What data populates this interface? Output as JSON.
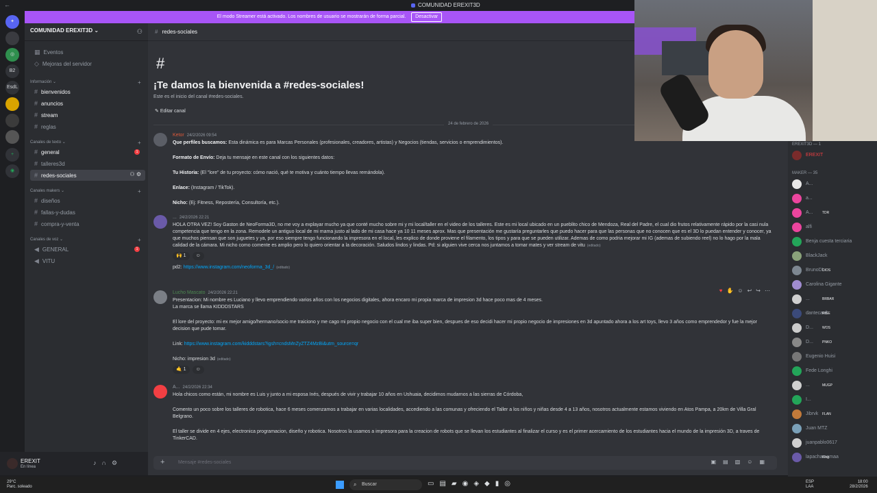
{
  "window": {
    "title": "COMUNIDAD EREXIT3D"
  },
  "banner": {
    "text": "El modo Streamer está activado. Los nombres de usuario se mostrarán de forma parcial.",
    "button": "Desactivar"
  },
  "rail": {
    "items": [
      "B2",
      "EsdL"
    ]
  },
  "server": {
    "name": "COMUNIDAD EREXIT3D"
  },
  "sidebar": {
    "top_items": [
      "Eventos",
      "Mejoras del servidor"
    ],
    "categories": {
      "info": "Información",
      "text": "Canales de texto",
      "makers": "Canales makers",
      "voice": "Canales de voz"
    },
    "info_channels": [
      "bienvenidos",
      "anuncios",
      "stream",
      "reglas"
    ],
    "text_channels": [
      "general",
      "talleres3d",
      "redes-sociales"
    ],
    "maker_channels": [
      "diseños",
      "fallas-y-dudas",
      "compra-y-venta"
    ],
    "voice_channels": [
      "GENERAL",
      "VITU"
    ],
    "general_badge": "1",
    "voice_badge": "1"
  },
  "user": {
    "name": "EREXIT",
    "status": "En línea"
  },
  "chat": {
    "channel": "redes-sociales",
    "welcome_title": "¡Te damos la bienvenida a #redes-sociales!",
    "welcome_sub": "Este es el inicio del canal #redes-sociales.",
    "edit_channel": "Editar canal",
    "date_divider": "24 de febrero de 2026",
    "input_placeholder": "Mensaje #redes-sociales",
    "edited": "(editado)"
  },
  "messages": [
    {
      "author": "Ketor",
      "timestamp": "24/2/2026 09:54",
      "p1_bold": "Que perfiles buscamos:",
      "p1": "Esta dinámica es para Marcas Personales (profesionales, creadores, artistas) y Negocios (tiendas, servicios o emprendimientos).",
      "p2_bold": "Formato de Envío:",
      "p2": "Deja tu mensaje en este canal con los siguientes datos:",
      "p3_bold": "Tu Historia:",
      "p3": "(El \"lore\" de tu proyecto: cómo nació, qué te motiva y cuánto tiempo llevas remándola).",
      "p4_bold": "Enlace:",
      "p4": "(Instagram / TikTok).",
      "p5_bold": "Nicho:",
      "p5": "(Ej: Fitness, Repostería, Consultoría, etc.)."
    },
    {
      "author": "...",
      "timestamp": "24/2/2026 22:21",
      "text": "HOLA OTRA VEZ! Soy Gaston de NeoForma3D, no me voy a explayar mucho ya que conté mucho sobre mi y mi local/taller en el video de los talleres. Este es mi local ubicado en un pueblito chico de Mendoza, Real del Padre, el cual dio frutos relativamente rápido por la casi nula competencia que tengo en la zona. Remodele un antiguo local de mi mama justo al lado de mi casa hace ya 10 11 meses aprox. Mas que presentación me gustaría preguntarles que puedo hacer para que las personas que no conocen que es el 3D lo puedan entender y conocer, ya que muchos piensan que son juguetes y ya, por eso siempre tengo funcionando la impresora en el local, les explico de donde proviene el filamento, los tipos y para que se pueden utilizar. Ademas de como podria mejorar mi IG (ademas de subiendo reel) no lo hago por la mala calidad de la cámara. Mi nicho como comente es amplio pero lo quiero orientar a la decoración. Saludos lindos y lindas. Pd: si alguien vive cerca nos juntamos a tomar mates y ver stream de vitu",
      "reaction": "🙌",
      "reaction_count": "1",
      "pd_label": "pd2:",
      "pd_link": "https://www.instagram.com/neoforma_3d_/"
    },
    {
      "author": "Lucho Mascato",
      "timestamp": "24/2/2026 22:21",
      "line1": "Presentacion: Mi nombre es Luciano y llevo emprendiendo varios años con los negocios digitales, ahora encaro mi propia marca de impresion 3d hace poco mas de 4 meses.",
      "line2": "La marca se llama KIDDDSTARS",
      "lore": "El lore del proyecto: mi ex mejor amigo/hermano/socio me traiciono y me cago mi propio negocio con el cual me iba super bien, despues de eso decidi hacer mi propio negocio de impresiones en 3d apuntado ahora a los art toys, llevo 3 años como emprendedor y fue la mejor decision que pude tomar.",
      "link_label": "Link:",
      "link": "https://www.instagram.com/kidddstars?igsh=cndsMnZyZTZ4MzBi&utm_source=qr",
      "nicho": "Nicho: impresion 3d",
      "reaction": "🤙",
      "reaction_count": "1"
    },
    {
      "author": "A...",
      "timestamp": "24/2/2026 22:34",
      "p1": "Hola chicos como están, mi nombre es Luis y junto a mi esposa Inés, después de vivir y trabajar 10 años en Ushuaia, decidimos mudarnos a las sierras de Córdoba,",
      "p2": "Comento un poco sobre los talleres de robotica, hace 6 meses comenzamos a trabajar en varias localidades, accediendo a las comunas y ofreciendo el Taller a los niños y niñas desde 4 a 13 años, nosotros actualmente estamos viviendo en Atos Pampa, a 20km de Villa Gral Belgrano.",
      "p3": "El taller se divide en 4 ejes, electronica programacion, diseño y robotica. Nosotros la usamos a impresora para la creacion de robots que se llevan los estudiantes al finalizar el curso y es el primer acercamiento de los estudiantes hacia el mundo de la impresión 3D, a traves de TinkerCAD."
    }
  ],
  "members": {
    "cat1": "EREXIT3D — 1",
    "owner": "EREXIT",
    "cat2": "MAKER — 35",
    "list": [
      {
        "name": "A...",
        "tag": ""
      },
      {
        "name": "a...",
        "tag": ""
      },
      {
        "name": "A...",
        "tag": "TDR"
      },
      {
        "name": "alfi",
        "tag": ""
      },
      {
        "name": "Benja cuesta terciaria",
        "tag": ""
      },
      {
        "name": "BlackJack",
        "tag": ""
      },
      {
        "name": "BrunoDL",
        "tag": "DIOS"
      },
      {
        "name": "Carolina Gigante",
        "tag": ""
      },
      {
        "name": "...",
        "tag": "BRBAR"
      },
      {
        "name": "dantecavil",
        "tag": "RISE"
      },
      {
        "name": "D...",
        "tag": "WOS"
      },
      {
        "name": "D...",
        "tag": "PNKO"
      },
      {
        "name": "Eugenio Huisi",
        "tag": ""
      },
      {
        "name": "Fede Longhi",
        "tag": ""
      },
      {
        "name": "...",
        "tag": "MUGP"
      },
      {
        "name": "I...",
        "tag": ""
      },
      {
        "name": "Jibrvk",
        "tag": "FLAN"
      },
      {
        "name": "Juan MTZ",
        "tag": ""
      },
      {
        "name": "juanpablo0617",
        "tag": ""
      },
      {
        "name": "lapachamamaa",
        "tag": "King"
      }
    ]
  },
  "taskbar": {
    "temp": "29°C",
    "weather": "Parc. soleado",
    "search": "Buscar",
    "lang1": "ESP",
    "lang2": "LAA",
    "time": "18:00",
    "date": "28/2/2026"
  },
  "colors": {
    "accent": "#5865f2",
    "banner": "#a855f7",
    "link": "#00a8fc",
    "badge": "#f23f43"
  }
}
